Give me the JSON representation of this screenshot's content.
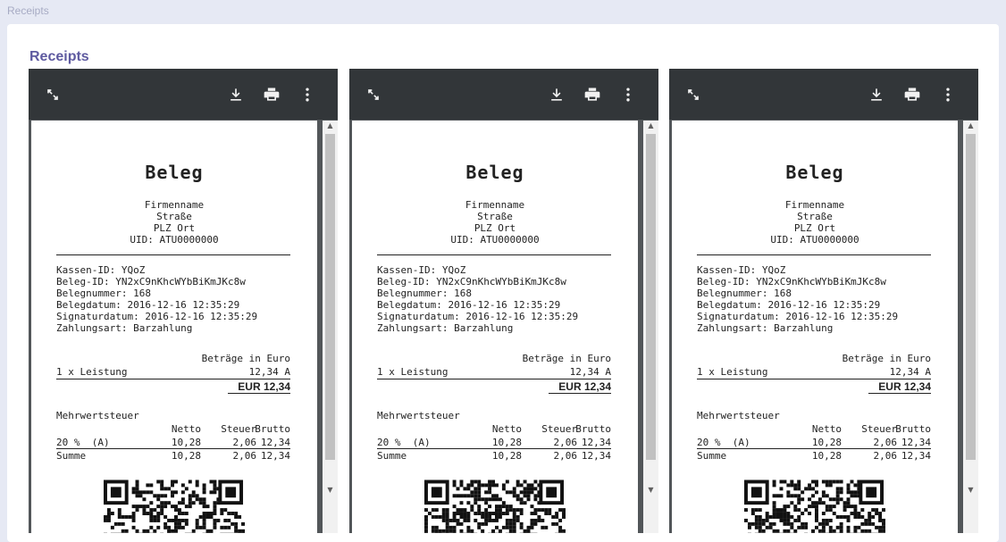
{
  "breadcrumb": "Receipts",
  "card_title": "Receipts",
  "viewer": {
    "icons": {
      "expand": "expand-icon",
      "download": "download-icon",
      "print": "print-icon",
      "more": "more-vert-icon"
    }
  },
  "receipts": [
    {
      "title": "Beleg",
      "company": "Firmenname",
      "street": "Straße",
      "city": "PLZ Ort",
      "uid": "UID: ATU0000000",
      "kassen_id": "Kassen-ID: YQoZ",
      "beleg_id": "Beleg-ID: YN2xC9nKhcWYbBiKmJKc8w",
      "belegnummer": "Belegnummer: 168",
      "belegdatum": "Belegdatum: 2016-12-16 12:35:29",
      "signaturdatum": "Signaturdatum: 2016-12-16 12:35:29",
      "zahlungsart": "Zahlungsart: Barzahlung",
      "betraege_header": "Beträge in Euro",
      "item_label": "1 x Leistung",
      "item_amount": "12,34 A",
      "total": "EUR 12,34",
      "mwst_label": "Mehrwertsteuer",
      "tax_headers": [
        "Netto",
        "Steuer",
        "Brutto"
      ],
      "tax_row": {
        "label": "20 %  (A)",
        "netto": "10,28",
        "steuer": "2,06",
        "brutto": "12,34"
      },
      "sum_row": {
        "label": "Summe",
        "netto": "10,28",
        "steuer": "2,06",
        "brutto": "12,34"
      }
    },
    {
      "title": "Beleg",
      "company": "Firmenname",
      "street": "Straße",
      "city": "PLZ Ort",
      "uid": "UID: ATU0000000",
      "kassen_id": "Kassen-ID: YQoZ",
      "beleg_id": "Beleg-ID: YN2xC9nKhcWYbBiKmJKc8w",
      "belegnummer": "Belegnummer: 168",
      "belegdatum": "Belegdatum: 2016-12-16 12:35:29",
      "signaturdatum": "Signaturdatum: 2016-12-16 12:35:29",
      "zahlungsart": "Zahlungsart: Barzahlung",
      "betraege_header": "Beträge in Euro",
      "item_label": "1 x Leistung",
      "item_amount": "12,34 A",
      "total": "EUR 12,34",
      "mwst_label": "Mehrwertsteuer",
      "tax_headers": [
        "Netto",
        "Steuer",
        "Brutto"
      ],
      "tax_row": {
        "label": "20 %  (A)",
        "netto": "10,28",
        "steuer": "2,06",
        "brutto": "12,34"
      },
      "sum_row": {
        "label": "Summe",
        "netto": "10,28",
        "steuer": "2,06",
        "brutto": "12,34"
      }
    },
    {
      "title": "Beleg",
      "company": "Firmenname",
      "street": "Straße",
      "city": "PLZ Ort",
      "uid": "UID: ATU0000000",
      "kassen_id": "Kassen-ID: YQoZ",
      "beleg_id": "Beleg-ID: YN2xC9nKhcWYbBiKmJKc8w",
      "belegnummer": "Belegnummer: 168",
      "belegdatum": "Belegdatum: 2016-12-16 12:35:29",
      "signaturdatum": "Signaturdatum: 2016-12-16 12:35:29",
      "zahlungsart": "Zahlungsart: Barzahlung",
      "betraege_header": "Beträge in Euro",
      "item_label": "1 x Leistung",
      "item_amount": "12,34 A",
      "total": "EUR 12,34",
      "mwst_label": "Mehrwertsteuer",
      "tax_headers": [
        "Netto",
        "Steuer",
        "Brutto"
      ],
      "tax_row": {
        "label": "20 %  (A)",
        "netto": "10,28",
        "steuer": "2,06",
        "brutto": "12,34"
      },
      "sum_row": {
        "label": "Summe",
        "netto": "10,28",
        "steuer": "2,06",
        "brutto": "12,34"
      }
    }
  ]
}
